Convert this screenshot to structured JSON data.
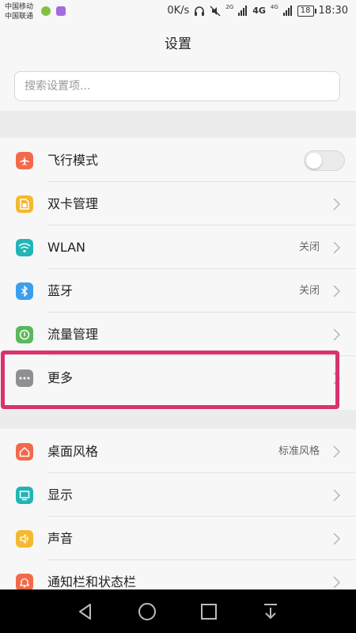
{
  "status_bar": {
    "carrier_1": "中国移动",
    "carrier_2": "中国联通",
    "net_speed": "0K/s",
    "battery": "18",
    "time": "18:30",
    "signal_tag_1": "2G",
    "signal_tag_2": "4G",
    "signal_tag_3": "4G"
  },
  "header": {
    "title": "设置"
  },
  "search": {
    "placeholder": "搜索设置项..."
  },
  "group1": [
    {
      "label": "飞行模式",
      "icon": "airplane-icon",
      "icon_color": "#f26a4b",
      "control": "toggle",
      "toggle_on": false
    },
    {
      "label": "双卡管理",
      "icon": "sim-card-icon",
      "icon_color": "#f5b82e",
      "control": "chevron"
    },
    {
      "label": "WLAN",
      "icon": "wifi-icon",
      "icon_color": "#22b5b5",
      "value": "关闭",
      "control": "chevron"
    },
    {
      "label": "蓝牙",
      "icon": "bluetooth-icon",
      "icon_color": "#3b9ff0",
      "value": "关闭",
      "control": "chevron"
    },
    {
      "label": "流量管理",
      "icon": "data-usage-icon",
      "icon_color": "#5bb85b",
      "control": "chevron"
    },
    {
      "label": "更多",
      "icon": "more-icon",
      "icon_color": "#8e8e93",
      "control": "chevron"
    }
  ],
  "group2": [
    {
      "label": "桌面风格",
      "icon": "home-style-icon",
      "icon_color": "#f26a4b",
      "value": "标准风格",
      "control": "chevron"
    },
    {
      "label": "显示",
      "icon": "display-icon",
      "icon_color": "#22b5b5",
      "control": "chevron"
    },
    {
      "label": "声音",
      "icon": "sound-icon",
      "icon_color": "#f5b82e",
      "control": "chevron"
    },
    {
      "label": "通知栏和状态栏",
      "icon": "notification-icon",
      "icon_color": "#f26a4b",
      "control": "chevron"
    }
  ],
  "colors": {
    "highlight": "#d8336f",
    "background": "#f7f7f7"
  }
}
